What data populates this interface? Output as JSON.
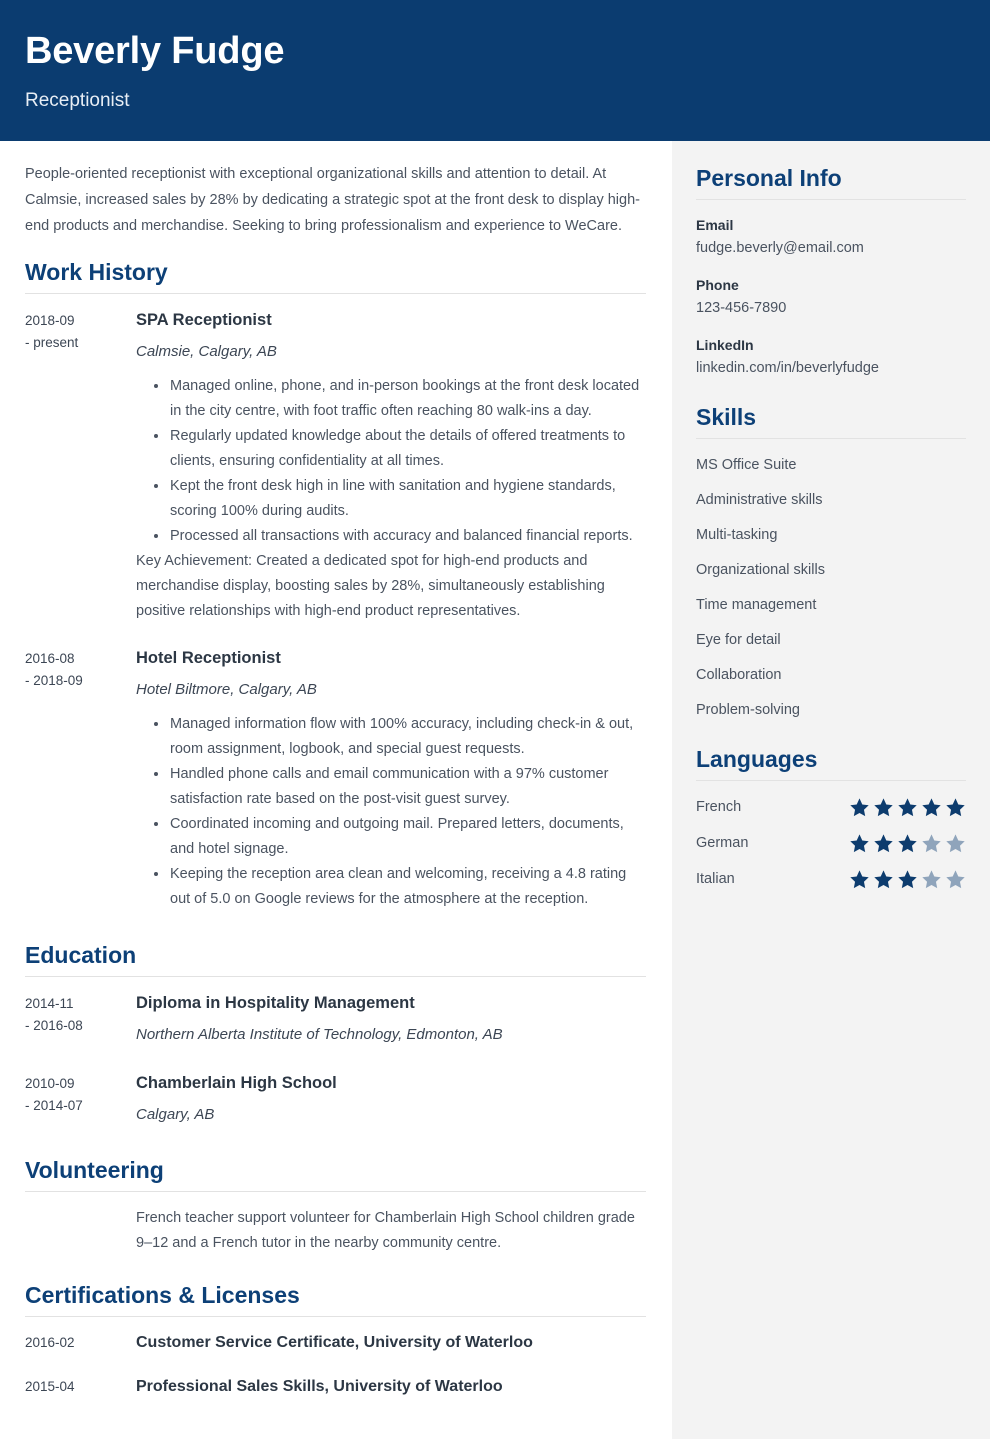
{
  "colors": {
    "header_bg": "#0b3c70",
    "heading": "#0d4077",
    "sidebar_bg": "#f3f3f3",
    "star_filled": "#0d3c6e",
    "star_empty": "#8fa4bb",
    "body_text": "#4a5360"
  },
  "header": {
    "name": "Beverly Fudge",
    "job_title": "Receptionist"
  },
  "summary": "People-oriented receptionist with exceptional organizational skills and attention to detail. At Calmsie, increased sales by 28% by dedicating a strategic spot at the front desk to display high-end products and merchandise. Seeking to bring professionalism and experience to WeCare.",
  "sections": {
    "work_history": {
      "title": "Work History",
      "entries": [
        {
          "date_start": "2018-09",
          "date_end": "- present",
          "role": "SPA Receptionist",
          "org": "Calmsie, Calgary, AB",
          "bullets": [
            "Managed online, phone, and in-person bookings at the front desk located in the city centre, with foot traffic often reaching 80 walk-ins a day.",
            "Regularly updated knowledge about the details of offered treatments to clients, ensuring confidentiality at all times.",
            "Kept the front desk high in line with sanitation and hygiene standards, scoring 100% during audits.",
            "Processed all transactions with accuracy and balanced financial reports."
          ],
          "note": "Key Achievement: Created a dedicated spot for high-end products and merchandise display, boosting sales by 28%, simultaneously establishing positive relationships with high-end product representatives."
        },
        {
          "date_start": "2016-08",
          "date_end": "- 2018-09",
          "role": "Hotel Receptionist",
          "org": "Hotel Biltmore, Calgary, AB",
          "bullets": [
            "Managed information flow with 100% accuracy, including check-in & out, room assignment, logbook, and special guest requests.",
            "Handled phone calls and email communication with a 97% customer satisfaction rate based on the post-visit guest survey.",
            "Coordinated incoming and outgoing mail. Prepared letters, documents, and hotel signage.",
            "Keeping the reception area clean and welcoming, receiving a 4.8 rating out of 5.0 on Google reviews for the atmosphere at the reception."
          ],
          "note": ""
        }
      ]
    },
    "education": {
      "title": "Education",
      "entries": [
        {
          "date_start": "2014-11",
          "date_end": "- 2016-08",
          "degree": "Diploma in Hospitality Management",
          "school": "Northern Alberta Institute of Technology, Edmonton, AB"
        },
        {
          "date_start": "2010-09",
          "date_end": "- 2014-07",
          "degree": "Chamberlain High School",
          "school": "Calgary, AB"
        }
      ]
    },
    "volunteering": {
      "title": "Volunteering",
      "text": "French teacher support volunteer for Chamberlain High School children grade 9–12 and a French tutor in the nearby community centre."
    },
    "certifications": {
      "title": "Certifications & Licenses",
      "entries": [
        {
          "date": "2016-02",
          "name": "Customer Service Certificate, University of Waterloo"
        },
        {
          "date": "2015-04",
          "name": "Professional Sales Skills, University of Waterloo"
        }
      ]
    }
  },
  "sidebar": {
    "personal_info": {
      "title": "Personal Info",
      "items": [
        {
          "label": "Email",
          "value": "fudge.beverly@email.com"
        },
        {
          "label": "Phone",
          "value": "123-456-7890"
        },
        {
          "label": "LinkedIn",
          "value": "linkedin.com/in/beverlyfudge"
        }
      ]
    },
    "skills": {
      "title": "Skills",
      "items": [
        "MS Office Suite",
        "Administrative skills",
        "Multi-tasking",
        "Organizational skills",
        "Time management",
        "Eye for detail",
        "Collaboration",
        "Problem-solving"
      ]
    },
    "languages": {
      "title": "Languages",
      "max_rating": 5,
      "items": [
        {
          "name": "French",
          "rating": 5
        },
        {
          "name": "German",
          "rating": 3
        },
        {
          "name": "Italian",
          "rating": 3
        }
      ]
    }
  }
}
